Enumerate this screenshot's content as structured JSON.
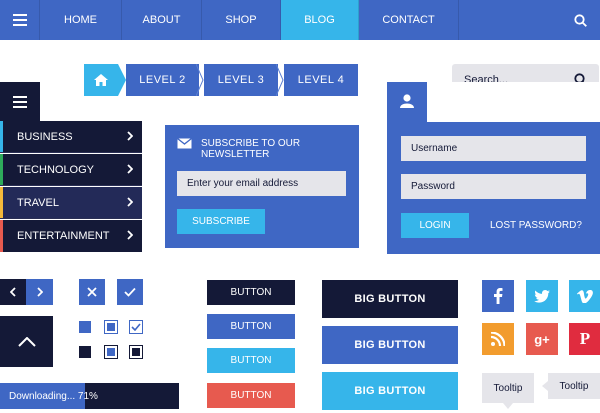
{
  "nav": {
    "items": [
      "HOME",
      "ABOUT",
      "SHOP",
      "BLOG",
      "CONTACT"
    ],
    "active_index": 3
  },
  "breadcrumb": {
    "levels": [
      "LEVEL 2",
      "LEVEL 3",
      "LEVEL 4"
    ]
  },
  "search": {
    "placeholder": "Search..."
  },
  "menu": {
    "items": [
      {
        "label": "BUSINESS",
        "color": "#36b5ea"
      },
      {
        "label": "TECHNOLOGY",
        "color": "#2eab5b"
      },
      {
        "label": "TRAVEL",
        "color": "#f4b93a"
      },
      {
        "label": "ENTERTAINMENT",
        "color": "#e75a4f"
      }
    ]
  },
  "newsletter": {
    "title": "SUBSCRIBE TO OUR NEWSLETTER",
    "email_placeholder": "Enter your email address",
    "subscribe_label": "SUBSCRIBE"
  },
  "login": {
    "username_placeholder": "Username",
    "password_placeholder": "Password",
    "login_label": "LOGIN",
    "lost_password_label": "LOST PASSWORD?"
  },
  "progress": {
    "label": "Downloading... 71%",
    "value": 0.71
  },
  "buttons": [
    "BUTTON",
    "BUTTON",
    "BUTTON",
    "BUTTON"
  ],
  "big_buttons": [
    "BIG BUTTON",
    "BIG BUTTON",
    "BIG BUTTON"
  ],
  "tooltips": [
    "Tooltip",
    "Tooltip"
  ],
  "social": [
    "facebook-icon",
    "twitter-icon",
    "vimeo-icon",
    "rss-icon",
    "google-plus-icon",
    "pinterest-icon"
  ],
  "colors": {
    "blue": "#3f67c4",
    "dark_navy": "#141937",
    "cyan": "#36b5ea",
    "red": "#e75a4f",
    "orange": "#f29c2e",
    "light_gray": "#e5e5ea"
  }
}
